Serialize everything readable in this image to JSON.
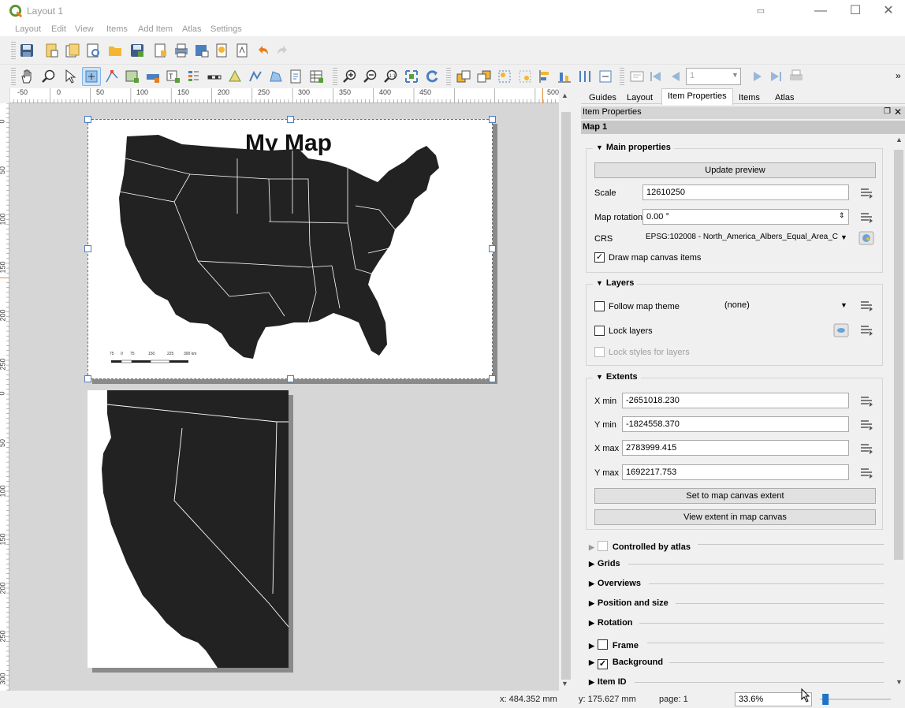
{
  "window": {
    "title": "Layout 1"
  },
  "menu": [
    "Layout",
    "Edit",
    "View",
    "Items",
    "Add Item",
    "Atlas",
    "Settings"
  ],
  "atlas_page": "1",
  "rulers": {
    "h_ticks": [
      "-50",
      "0",
      "50",
      "100",
      "150",
      "200",
      "250",
      "300",
      "350",
      "400",
      "450",
      "500"
    ],
    "v_ticks_top": [
      "0",
      "50",
      "100",
      "150",
      "200",
      "250"
    ],
    "v_ticks_bottom": [
      "0",
      "50",
      "100",
      "150",
      "200",
      "250",
      "300"
    ]
  },
  "map": {
    "title": "My Map",
    "scalebar_labels": [
      "75",
      "0",
      "75",
      "150",
      "225",
      "300 km"
    ]
  },
  "status": {
    "x": "x: 484.352 mm",
    "y": "y: 175.627 mm",
    "page": "page: 1",
    "zoom": "33.6%",
    "zoom_level": 0.06
  },
  "panel": {
    "tabs": [
      "Guides",
      "Layout",
      "Item Properties",
      "Items",
      "Atlas"
    ],
    "active_tab": "Item Properties",
    "header": "Item Properties",
    "item_name": "Map 1",
    "main_properties": {
      "title": "Main properties",
      "update_preview": "Update preview",
      "scale_label": "Scale",
      "scale_value": "12610250",
      "rotation_label": "Map rotation",
      "rotation_value": "0.00 °",
      "crs_label": "CRS",
      "crs_value": "EPSG:102008 - North_America_Albers_Equal_Area_C",
      "draw_canvas_items": "Draw map canvas items",
      "draw_canvas_items_checked": true
    },
    "layers": {
      "title": "Layers",
      "follow_theme": "Follow map theme",
      "theme_value": "(none)",
      "lock_layers": "Lock layers",
      "lock_styles": "Lock styles for layers"
    },
    "extents": {
      "title": "Extents",
      "xmin_label": "X min",
      "xmin": "-2651018.230",
      "ymin_label": "Y min",
      "ymin": "-1824558.370",
      "xmax_label": "X max",
      "xmax": "2783999.415",
      "ymax_label": "Y max",
      "ymax": "1692217.753",
      "set_to_canvas": "Set to map canvas extent",
      "view_in_canvas": "View extent in map canvas"
    },
    "collapsed": [
      "Controlled by atlas",
      "Grids",
      "Overviews",
      "Position and size",
      "Rotation",
      "Frame",
      "Background",
      "Item ID"
    ],
    "background_checked": true
  }
}
